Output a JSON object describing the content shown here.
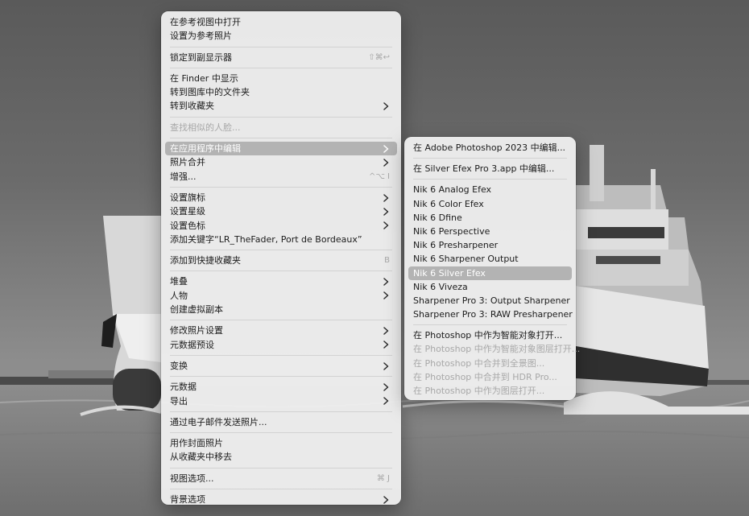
{
  "main_menu": {
    "groups": [
      [
        {
          "label": "在参考视图中打开"
        },
        {
          "label": "设置为参考照片"
        }
      ],
      [
        {
          "label": "锁定到副显示器",
          "shortcut": "⇧⌘↩"
        }
      ],
      [
        {
          "label": "在 Finder 中显示"
        },
        {
          "label": "转到图库中的文件夹"
        },
        {
          "label": "转到收藏夹",
          "submenu": true
        }
      ],
      [
        {
          "label": "查找相似的人脸...",
          "disabled": true
        }
      ],
      [
        {
          "label": "在应用程序中编辑",
          "submenu": true,
          "highlight": true
        },
        {
          "label": "照片合并",
          "submenu": true
        },
        {
          "label": "增强...",
          "shortcut": "^⌥ I"
        }
      ],
      [
        {
          "label": "设置旗标",
          "submenu": true
        },
        {
          "label": "设置星级",
          "submenu": true
        },
        {
          "label": "设置色标",
          "submenu": true
        },
        {
          "label": "添加关键字“LR_TheFader, Port de Bordeaux”"
        }
      ],
      [
        {
          "label": "添加到快捷收藏夹",
          "shortcut": "B"
        }
      ],
      [
        {
          "label": "堆叠",
          "submenu": true
        },
        {
          "label": "人物",
          "submenu": true
        },
        {
          "label": "创建虚拟副本"
        }
      ],
      [
        {
          "label": "修改照片设置",
          "submenu": true
        },
        {
          "label": "元数据预设",
          "submenu": true
        }
      ],
      [
        {
          "label": "变换",
          "submenu": true
        }
      ],
      [
        {
          "label": "元数据",
          "submenu": true
        },
        {
          "label": "导出",
          "submenu": true
        }
      ],
      [
        {
          "label": "通过电子邮件发送照片..."
        }
      ],
      [
        {
          "label": "用作封面照片"
        },
        {
          "label": "从收藏夹中移去"
        }
      ],
      [
        {
          "label": "视图选项...",
          "shortcut": "⌘ J"
        }
      ],
      [
        {
          "label": "背景选项",
          "submenu": true
        }
      ]
    ]
  },
  "sub_menu": {
    "groups": [
      [
        {
          "label": "在 Adobe Photoshop 2023 中编辑..."
        }
      ],
      [
        {
          "label": "在 Silver Efex Pro 3.app 中编辑..."
        }
      ],
      [
        {
          "label": "Nik 6 Analog Efex"
        },
        {
          "label": "Nik 6 Color Efex"
        },
        {
          "label": "Nik 6 Dfine"
        },
        {
          "label": "Nik 6 Perspective"
        },
        {
          "label": "Nik 6 Presharpener"
        },
        {
          "label": "Nik 6 Sharpener Output"
        },
        {
          "label": "Nik 6 Silver Efex",
          "highlight": true
        },
        {
          "label": "Nik 6 Viveza"
        },
        {
          "label": "Sharpener Pro 3: Output Sharpener"
        },
        {
          "label": "Sharpener Pro 3: RAW Presharpener"
        }
      ],
      [
        {
          "label": "在 Photoshop 中作为智能对象打开..."
        },
        {
          "label": "在 Photoshop 中作为智能对象图层打开...",
          "disabled": true
        },
        {
          "label": "在 Photoshop 中合并到全景图...",
          "disabled": true
        },
        {
          "label": "在 Photoshop 中合并到 HDR Pro...",
          "disabled": true
        },
        {
          "label": "在 Photoshop 中作为图层打开...",
          "disabled": true
        }
      ]
    ]
  }
}
